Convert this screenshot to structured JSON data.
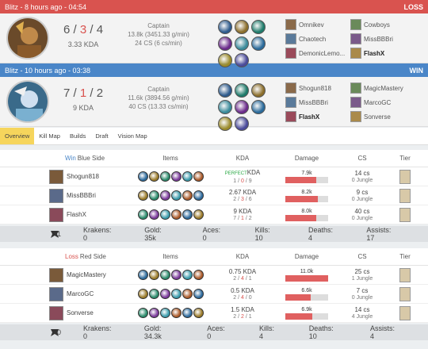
{
  "matches": [
    {
      "header": "Blitz - 8 hours ago - 04:54",
      "result": "LOSS",
      "kills": "6",
      "deaths": "3",
      "assists": "4",
      "kda": "3.33 KDA",
      "role": "Captain",
      "damage": "13.8k (3451.33 g/min)",
      "cs": "24 CS (6 cs/min)",
      "team_left": [
        "Omnikev",
        "Chaotech",
        "DemonicLemo..."
      ],
      "team_right": [
        "Cowboys",
        "MissBBBri",
        "FlashX"
      ],
      "item_colors": [
        "#2d5a8c",
        "#8a6d2a",
        "#1e7a6a",
        "#6a2a8a",
        "#3a8a9a",
        "#2a6a9a",
        "#9a8a2a",
        "#4a4a9a"
      ],
      "accent": "#d9534f"
    },
    {
      "header": "Blitz - 10 hours ago - 03:38",
      "result": "WIN",
      "kills": "7",
      "deaths": "1",
      "assists": "2",
      "kda": "9 KDA",
      "role": "Captain",
      "damage": "11.6k (3894.56 g/min)",
      "cs": "40 CS (13.33 cs/min)",
      "team_left": [
        "Shogun818",
        "MissBBBri",
        "FlashX"
      ],
      "team_right": [
        "MagicMastery",
        "MarcoGC",
        "Sonverse"
      ],
      "item_colors": [
        "#2d5a8c",
        "#1e7a6a",
        "#8a6d2a",
        "#3a8a9a",
        "#6a2a8a",
        "#2a6a9a",
        "#9a8a2a",
        "#4a4a9a"
      ],
      "accent": "#4a86c8"
    }
  ],
  "tabs": [
    "Overview",
    "Kill Map",
    "Builds",
    "Draft",
    "Vision Map"
  ],
  "columns": {
    "items": "Items",
    "kda": "KDA",
    "damage": "Damage",
    "cs": "CS",
    "tier": "Tier"
  },
  "blue_side": {
    "result": "Win",
    "label": "Blue Side",
    "players": [
      {
        "name": "Shogun818",
        "perfect": "PERFECT",
        "kda": "KDA",
        "k": "1",
        "d": "0",
        "a": "9",
        "damage": "7.9k",
        "dmg_pct": 0.72,
        "cs": "14 cs",
        "jungle": "0 Jungle"
      },
      {
        "name": "MissBBBri",
        "perfect": "",
        "kda": "2.67 KDA",
        "k": "2",
        "d": "3",
        "a": "6",
        "damage": "8.2k",
        "dmg_pct": 0.75,
        "cs": "9 cs",
        "jungle": "0 Jungle"
      },
      {
        "name": "FlashX",
        "perfect": "",
        "kda": "9 KDA",
        "k": "7",
        "d": "1",
        "a": "2",
        "damage": "8.0k",
        "dmg_pct": 0.73,
        "cs": "40 cs",
        "jungle": "0 Jungle"
      }
    ],
    "summary": {
      "count": "1",
      "krakens": "Krakens: 0",
      "gold": "Gold: 35k",
      "aces": "Aces: 0",
      "kills": "Kills: 10",
      "deaths": "Deaths: 4",
      "assists": "Assists: 17"
    }
  },
  "red_side": {
    "result": "Loss",
    "label": "Red Side",
    "players": [
      {
        "name": "MagicMastery",
        "perfect": "",
        "kda": "0.75 KDA",
        "k": "2",
        "d": "4",
        "a": "1",
        "damage": "11.0k",
        "dmg_pct": 1.0,
        "cs": "25 cs",
        "jungle": "1 Jungle"
      },
      {
        "name": "MarcoGC",
        "perfect": "",
        "kda": "0.5 KDA",
        "k": "2",
        "d": "4",
        "a": "0",
        "damage": "6.6k",
        "dmg_pct": 0.6,
        "cs": "7 cs",
        "jungle": "0 Jungle"
      },
      {
        "name": "Sonverse",
        "perfect": "",
        "kda": "1.5 KDA",
        "k": "2",
        "d": "2",
        "a": "1",
        "damage": "6.9k",
        "dmg_pct": 0.63,
        "cs": "14 cs",
        "jungle": "4 Jungle"
      }
    ],
    "summary": {
      "count": "0",
      "krakens": "Krakens: 0",
      "gold": "Gold: 34.3k",
      "aces": "Aces: 0",
      "kills": "Kills: 4",
      "deaths": "Deaths: 10",
      "assists": "Assists: 4"
    }
  }
}
